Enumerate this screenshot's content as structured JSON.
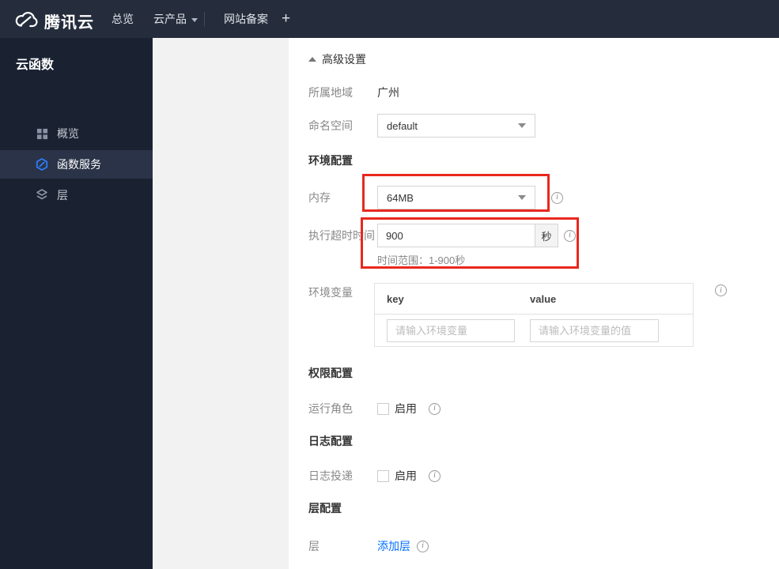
{
  "colors": {
    "annotation_red": "#e8281e",
    "link_blue": "#006eff",
    "topbar_bg": "#252d3c",
    "sidebar_bg": "#1a2232",
    "sidebar_selected_bg": "#2a3347",
    "panel_gray": "#f2f2f2",
    "brand_icon_blue": "#2d7dfa"
  },
  "icons": {
    "info_glyph": "i",
    "plus_glyph": "+"
  },
  "topbar": {
    "logo_text": "腾讯云",
    "nav": [
      {
        "label": "总览"
      },
      {
        "label": "云产品"
      },
      {
        "label": "网站备案"
      }
    ]
  },
  "sidebar": {
    "title": "云函数",
    "items": [
      {
        "label": "概览",
        "icon": "grid-icon",
        "selected": false
      },
      {
        "label": "函数服务",
        "icon": "function-hexagon-icon",
        "selected": true
      },
      {
        "label": "层",
        "icon": "layers-icon",
        "selected": false
      }
    ]
  },
  "form": {
    "advanced_settings_label": "高级设置",
    "region": {
      "label": "所属地域",
      "value": "广州"
    },
    "namespace": {
      "label": "命名空间",
      "value": "default"
    },
    "env_section_title": "环境配置",
    "memory": {
      "label": "内存",
      "value": "64MB"
    },
    "timeout": {
      "label": "执行超时时间",
      "value": "900",
      "unit": "秒",
      "hint": "时间范围：1-900秒"
    },
    "env_vars": {
      "label": "环境变量",
      "key_header": "key",
      "value_header": "value",
      "key_placeholder": "请输入环境变量",
      "value_placeholder": "请输入环境变量的值"
    },
    "perm_section_title": "权限配置",
    "run_role": {
      "label": "运行角色",
      "checkbox_label": "启用",
      "checked": false
    },
    "log_section_title": "日志配置",
    "log_delivery": {
      "label": "日志投递",
      "checkbox_label": "启用",
      "checked": false
    },
    "layer_section_title": "层配置",
    "layer": {
      "label": "层",
      "add_link": "添加层"
    }
  }
}
